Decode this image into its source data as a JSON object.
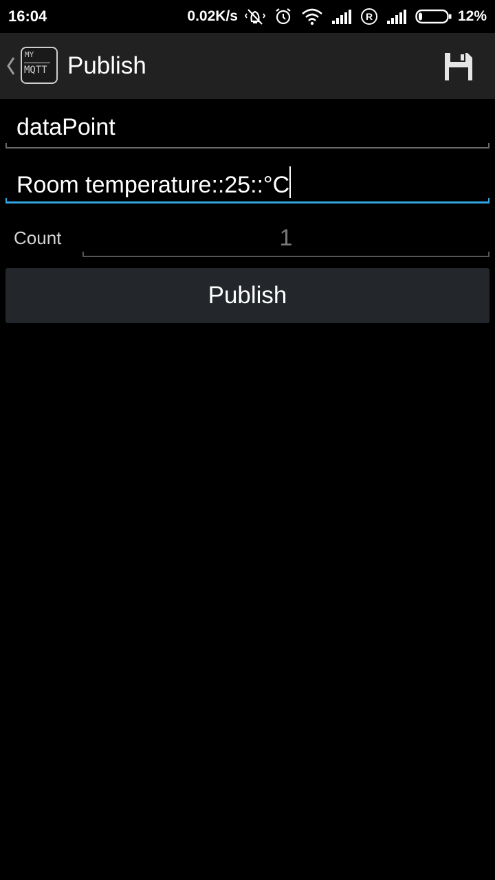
{
  "status_bar": {
    "time": "16:04",
    "net_speed": "0.02K/s",
    "battery_percent": "12%",
    "icons": [
      "vibrate-icon",
      "alarm-icon",
      "wifi-icon",
      "signal-icon",
      "roaming-icon",
      "signal-icon",
      "battery-icon"
    ]
  },
  "action_bar": {
    "logo_top": "MY",
    "logo_bottom": "MQTT",
    "title": "Publish",
    "save_icon": "save-icon"
  },
  "form": {
    "topic_value": "dataPoint",
    "payload_value": "Room temperature::25::°C",
    "count_label": "Count",
    "count_value": "1",
    "publish_label": "Publish"
  },
  "colors": {
    "accent": "#33a5e0",
    "action_bar_bg": "#212121",
    "button_bg": "#23272b",
    "background": "#000000"
  }
}
